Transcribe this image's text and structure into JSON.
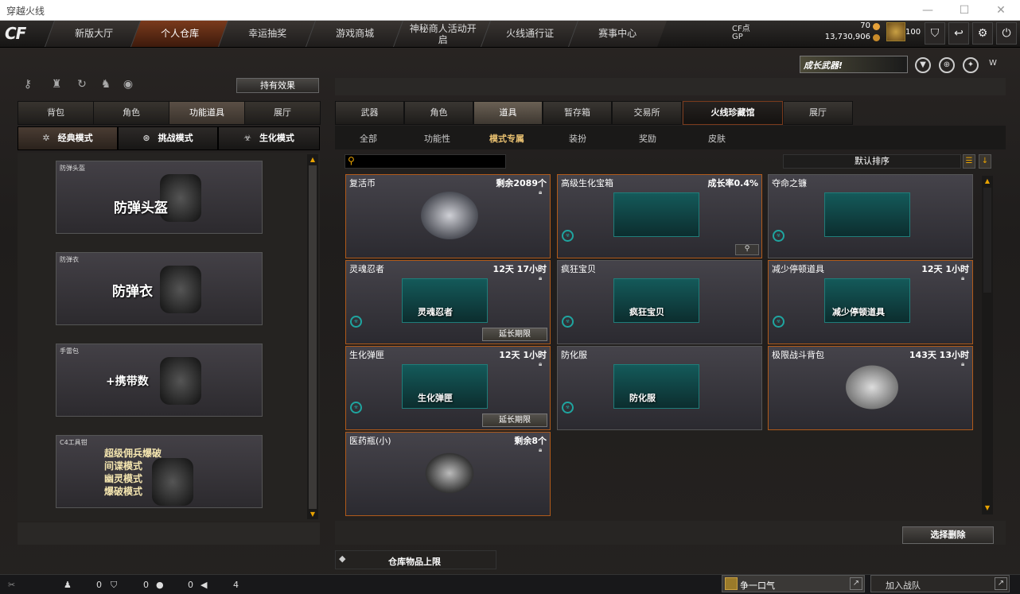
{
  "window": {
    "title": "穿越火线"
  },
  "nav": {
    "logo": "CF",
    "tabs": [
      "新版大厅",
      "个人仓库",
      "幸运抽奖",
      "游戏商城",
      "神秘商人活动开启",
      "火线通行证",
      "赛事中心"
    ],
    "active": 1
  },
  "currency": {
    "cf_label": "CF点",
    "cf_value": "70",
    "gp_label": "GP",
    "gp_value": "13,730,906",
    "level": "100"
  },
  "banner": {
    "text": "成长武器!"
  },
  "left": {
    "hold_button": "持有效果",
    "tabs": [
      "背包",
      "角色",
      "功能道具",
      "展厅"
    ],
    "active_tab": 2,
    "modes": [
      "经典模式",
      "挑战模式",
      "生化模式"
    ],
    "active_mode": 0,
    "items": [
      {
        "label": "防弹头盔",
        "title": "防弹头盔"
      },
      {
        "label": "防弹衣",
        "title": "防弹衣"
      },
      {
        "label": "手雷包",
        "title": "+携带数"
      },
      {
        "label": "C4工具钳",
        "title": "超级佣兵爆破\n间谍模式\n幽灵模式\n爆破模式"
      }
    ]
  },
  "right": {
    "tabs": [
      "武器",
      "角色",
      "道具",
      "暂存箱",
      "交易所",
      "火线珍藏馆",
      "展厅"
    ],
    "active_tab": 2,
    "highlight_tab": 5,
    "subtabs": [
      "全部",
      "功能性",
      "模式专属",
      "装扮",
      "奖励",
      "皮肤"
    ],
    "active_sub": 2,
    "search_placeholder": "",
    "sort_label": "默认排序",
    "cards": [
      {
        "name": "复活币",
        "right": "剩余2089个",
        "art": "",
        "extend": ""
      },
      {
        "name": "高级生化宝箱",
        "right": "成长率0.4%",
        "art": "",
        "extend": ""
      },
      {
        "name": "夺命之镰",
        "right": "",
        "art": "",
        "extend": ""
      },
      {
        "name": "灵魂忍者",
        "right": "12天 17小时",
        "art": "灵魂忍者",
        "extend": "延长期限"
      },
      {
        "name": "疯狂宝贝",
        "right": "",
        "art": "疯狂宝贝",
        "extend": ""
      },
      {
        "name": "减少停顿道具",
        "right": "12天 1小时",
        "art": "减少停顿道具",
        "extend": ""
      },
      {
        "name": "生化弹匣",
        "right": "12天 1小时",
        "art": "生化弹匣",
        "extend": "延长期限"
      },
      {
        "name": "防化服",
        "right": "",
        "art": "防化服",
        "extend": ""
      },
      {
        "name": "极限战斗背包",
        "right": "143天 13小时",
        "art": "",
        "extend": ""
      },
      {
        "name": "医药瓶(小)",
        "right": "剩余8个",
        "art": "",
        "extend": ""
      }
    ],
    "delete_button": "选择删除",
    "capacity_label": "仓库物品上限"
  },
  "status": {
    "c1": "0",
    "c2": "0",
    "c3": "0",
    "c4": "4",
    "chat_text": "争一口气",
    "join_text": "加入战队"
  }
}
